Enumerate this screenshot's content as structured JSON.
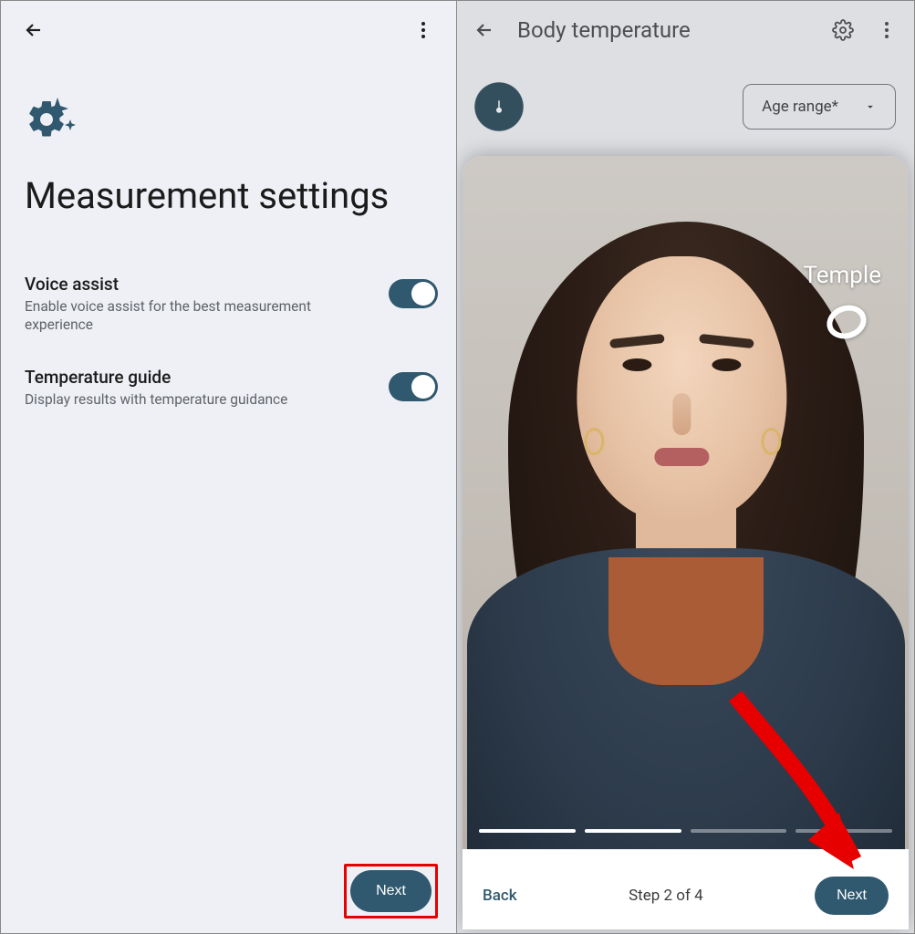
{
  "left": {
    "title": "Measurement settings",
    "settings": [
      {
        "title": "Voice assist",
        "subtitle": "Enable voice assist for the best measurement experience",
        "on": true
      },
      {
        "title": "Temperature guide",
        "subtitle": "Display results with temperature guidance",
        "on": true
      }
    ],
    "next_label": "Next"
  },
  "right": {
    "app_title": "Body temperature",
    "age_label": "Age range*",
    "photo_label": "Temple",
    "step_label": "Step 2 of 4",
    "back_label": "Back",
    "next_label": "Next",
    "progress": {
      "total": 4,
      "current": 2
    }
  }
}
